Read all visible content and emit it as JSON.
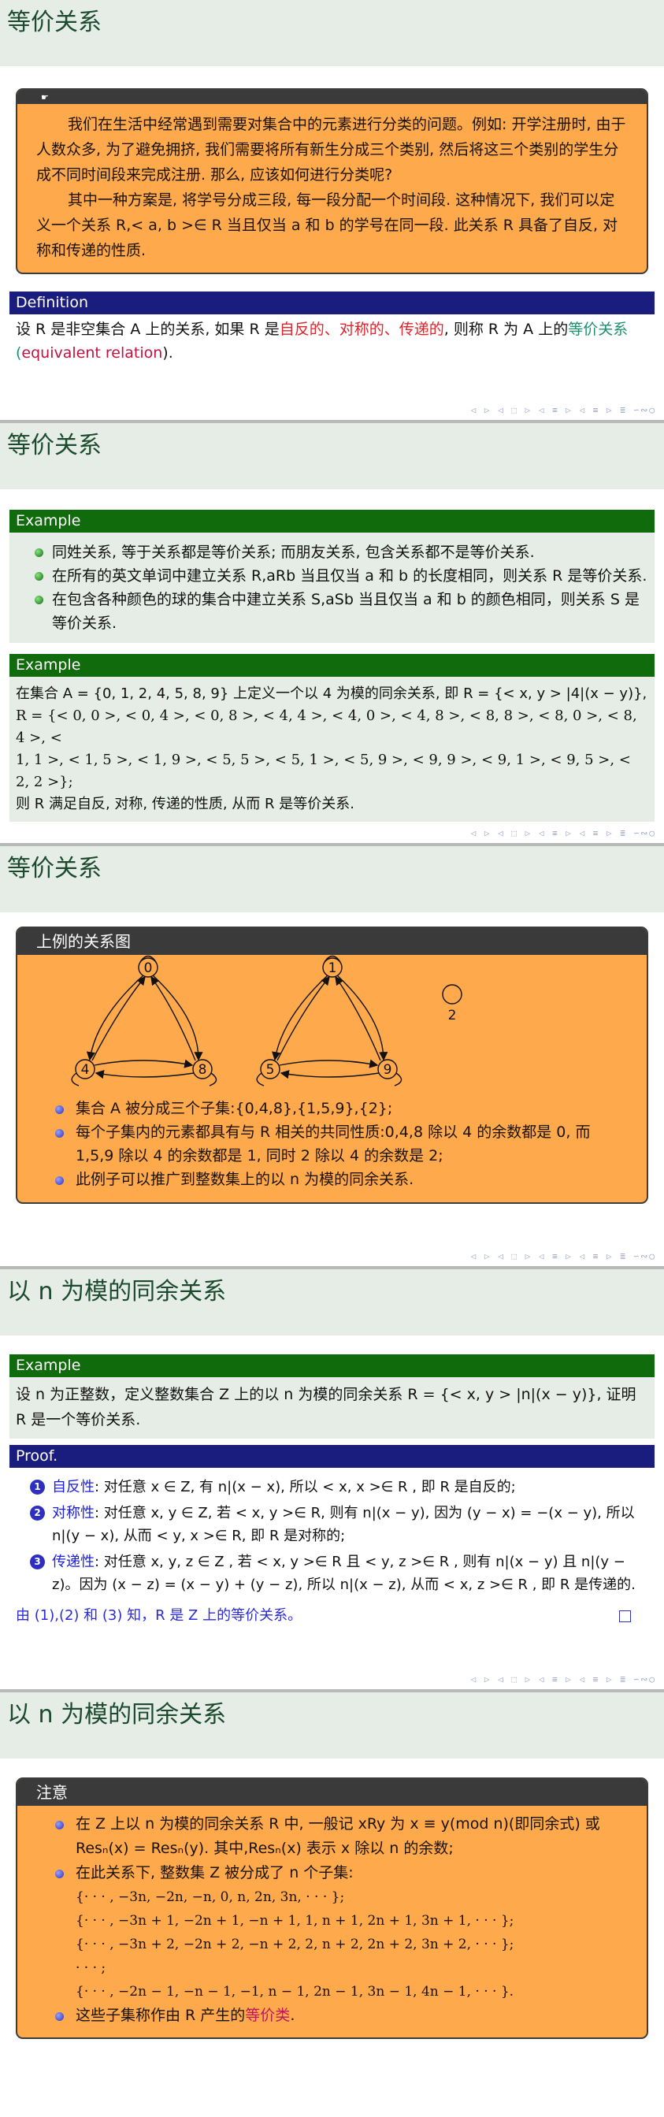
{
  "nav_glyphs": "◁ ▷ ◁ ⬚ ▷ ◁ ≡ ▷ ◁ ≡ ▷ ≣ ∽∾◯",
  "slide1": {
    "title": "等价关系",
    "note_icon": "hand-pointing-icon",
    "para1": "我们在生活中经常遇到需要对集合中的元素进行分类的问题。例如: 开学注册时, 由于人数众多, 为了避免拥挤, 我们需要将所有新生分成三个类别, 然后将这三个类别的学生分成不同时间段来完成注册. 那么, 应该如何进行分类呢?",
    "para2": "其中一种方案是, 将学号分成三段, 每一段分配一个时间段. 这种情况下, 我们可以定义一个关系 R,< a, b >∈ R 当且仅当 a 和 b 的学号在同一段. 此关系 R 具备了自反, 对称和传递的性质.",
    "def_title": "Definition",
    "def_pre": "设 R 是非空集合 A 上的关系, 如果 R 是",
    "def_reflexive": "自反的、",
    "def_symmetric": "对称的、",
    "def_transitive": "传递的",
    "def_mid": ", 则称 R 为 A 上的",
    "def_equiv": "等价关系",
    "def_lparen": "(",
    "def_eng": "equivalent relation",
    "def_rparen": ")."
  },
  "slide2": {
    "title": "等价关系",
    "ex1_title": "Example",
    "ex1_items": [
      "同姓关系, 等于关系都是等价关系; 而朋友关系, 包含关系都不是等价关系.",
      "在所有的英文单词中建立关系 R,aRb 当且仅当 a 和 b 的长度相同，则关系 R 是等价关系.",
      "在包含各种颜色的球的集合中建立关系 S,aSb 当且仅当 a 和 b 的颜色相同，则关系 S 是等价关系."
    ],
    "ex2_title": "Example",
    "ex2_line1": "在集合 A = {0, 1, 2, 4, 5, 8, 9} 上定义一个以 4 为模的同余关系, 即 R = {< x, y > |4|(x − y)},",
    "ex2_line2": "R = {< 0, 0 >, < 0, 4 >, < 0, 8 >, < 4, 4 >, < 4, 0 >, < 4, 8 >, < 8, 8 >, < 8, 0 >, < 8, 4 >, <",
    "ex2_line3": "1, 1 >, < 1, 5 >, < 1, 9 >, < 5, 5 >, < 5, 1 >, < 5, 9 >, < 9, 9 >, < 9, 1 >, < 9, 5 >, < 2, 2 >};",
    "ex2_line4": "则 R 满足自反, 对称, 传递的性质, 从而 R 是等价关系."
  },
  "slide3": {
    "title": "等价关系",
    "box_title": "上例的关系图",
    "nodes": [
      "0",
      "4",
      "8",
      "1",
      "5",
      "9",
      "2"
    ],
    "items": [
      "集合 A 被分成三个子集:{0,4,8},{1,5,9},{2};",
      "每个子集内的元素都具有与 R 相关的共同性质:0,4,8 除以 4 的余数都是 0, 而 1,5,9 除以 4 的余数都是 1, 同时 2 除以 4 的余数是 2;",
      "此例子可以推广到整数集上的以 n 为模的同余关系."
    ]
  },
  "slide4": {
    "title": "以 n 为模的同余关系",
    "ex_title": "Example",
    "ex_text": "设 n 为正整数，定义整数集合 Z 上的以 n 为模的同余关系 R = {< x, y > |n|(x − y)}, 证明 R 是一个等价关系.",
    "proof_title": "Proof.",
    "items": [
      {
        "num": "1",
        "label": "自反性",
        "text": ": 对任意 x ∈ Z, 有 n|(x − x), 所以 < x, x >∈ R , 即 R 是自反的;"
      },
      {
        "num": "2",
        "label": "对称性",
        "text": ": 对任意 x, y ∈ Z, 若 < x, y >∈ R, 则有 n|(x − y), 因为 (y − x) = −(x − y), 所以 n|(y − x), 从而 < y, x >∈ R, 即 R 是对称的;"
      },
      {
        "num": "3",
        "label": "传递性",
        "text": ": 对任意 x, y, z ∈ Z , 若 < x, y >∈ R 且 < y, z >∈ R , 则有 n|(x − y) 且 n|(y − z)。因为 (x − z) = (x − y) + (y − z), 所以 n|(x − z), 从而 < x, z >∈ R , 即 R 是传递的."
      }
    ],
    "conclusion": "由 (1),(2) 和 (3) 知，R 是 Z 上的等价关系。"
  },
  "slide5": {
    "title": "以 n 为模的同余关系",
    "box_title": "注意",
    "item1": "在 Z 上以 n 为模的同余关系 R 中, 一般记 xRy 为 x ≡ y(mod n)(即同余式) 或 Resₙ(x) = Resₙ(y). 其中,Resₙ(x) 表示 x 除以 n 的余数;",
    "item2": "在此关系下, 整数集 Z 被分成了 n 个子集:",
    "sets": [
      "{· · · , −3n, −2n, −n, 0, n, 2n, 3n, · · · };",
      "{· · · , −3n + 1, −2n + 1, −n + 1, 1, n + 1, 2n + 1, 3n + 1, · · · };",
      "{· · · , −3n + 2, −2n + 2, −n + 2, 2, n + 2, 2n + 2, 3n + 2, · · · };",
      "· · · ;",
      "{· · · , −2n − 1, −n − 1, −1, n − 1, 2n − 1, 3n − 1, 4n − 1, · · · }."
    ],
    "item3_pre": "这些子集称作由 R 产生的",
    "item3_hl": "等价类",
    "item3_post": "."
  }
}
